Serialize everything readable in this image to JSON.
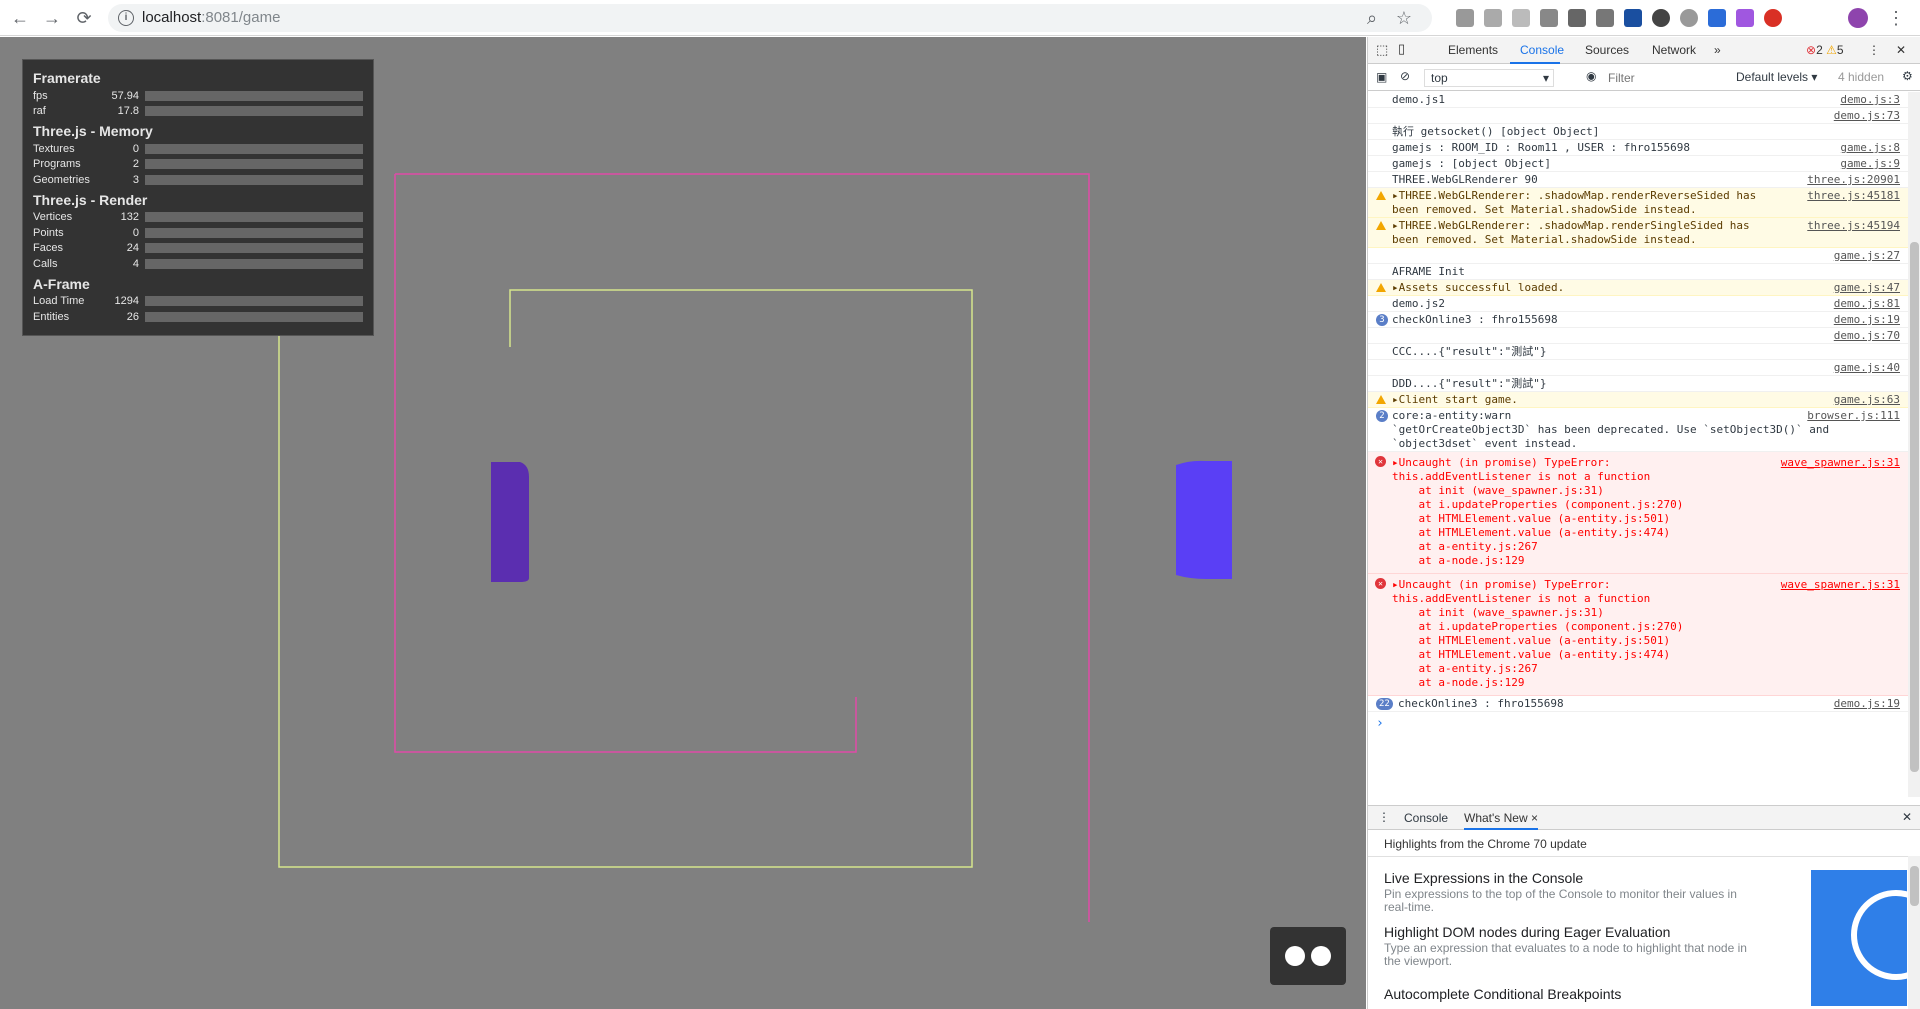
{
  "browser": {
    "url_host": "localhost",
    "url_rest": ":8081/game"
  },
  "stats": {
    "sections": [
      {
        "title": "Framerate",
        "rows": [
          {
            "k": "fps",
            "v": "57.94"
          },
          {
            "k": "raf",
            "v": "17.8"
          }
        ]
      },
      {
        "title": "Three.js - Memory",
        "rows": [
          {
            "k": "Textures",
            "v": "0"
          },
          {
            "k": "Programs",
            "v": "2"
          },
          {
            "k": "Geometries",
            "v": "3"
          }
        ]
      },
      {
        "title": "Three.js - Render",
        "rows": [
          {
            "k": "Vertices",
            "v": "132"
          },
          {
            "k": "Points",
            "v": "0"
          },
          {
            "k": "Faces",
            "v": "24"
          },
          {
            "k": "Calls",
            "v": "4"
          }
        ]
      },
      {
        "title": "A-Frame",
        "rows": [
          {
            "k": "Load Time",
            "v": "1294"
          },
          {
            "k": "Entities",
            "v": "26"
          }
        ]
      }
    ]
  },
  "devtools": {
    "tabs": [
      "Elements",
      "Console",
      "Sources",
      "Network"
    ],
    "active_tab": "Console",
    "more_tabs": "»",
    "error_count": "2",
    "warning_count": "5",
    "context": "top",
    "filter_placeholder": "Filter",
    "levels": "Default levels",
    "hidden": "4 hidden",
    "colors": {
      "accent": "#1a73e8",
      "error": "#ff0000",
      "warn_bg": "#fffbe5",
      "err_bg": "#fff0f0"
    },
    "messages": [
      {
        "type": "log",
        "text": "demo.js1",
        "src": "demo.js:3"
      },
      {
        "type": "log",
        "text": "",
        "src": "demo.js:73"
      },
      {
        "type": "log",
        "text": "執行 getsocket() [object Object]",
        "src": ""
      },
      {
        "type": "log",
        "text": "gamejs : ROOM_ID : Room11 , USER : fhro155698",
        "src": "game.js:8"
      },
      {
        "type": "log",
        "text": "gamejs : [object Object]",
        "src": "game.js:9"
      },
      {
        "type": "log",
        "text": "THREE.WebGLRenderer 90",
        "src": "three.js:20901"
      },
      {
        "type": "warn",
        "text": "▸THREE.WebGLRenderer: .shadowMap.renderReverseSided has\nbeen removed. Set Material.shadowSide instead.",
        "src": "three.js:45181"
      },
      {
        "type": "warn",
        "text": "▸THREE.WebGLRenderer: .shadowMap.renderSingleSided has\nbeen removed. Set Material.shadowSide instead.",
        "src": "three.js:45194"
      },
      {
        "type": "log",
        "text": "",
        "src": "game.js:27"
      },
      {
        "type": "log",
        "text": "AFRAME Init",
        "src": ""
      },
      {
        "type": "warn",
        "text": "▸Assets successful loaded.",
        "src": "game.js:47"
      },
      {
        "type": "log",
        "text": "demo.js2",
        "src": "demo.js:81"
      },
      {
        "type": "count",
        "badge": "3",
        "text": "checkOnline3 : fhro155698",
        "src": "demo.js:19"
      },
      {
        "type": "log",
        "text": "",
        "src": "demo.js:70"
      },
      {
        "type": "log",
        "text": "CCC....{\"result\":\"測試\"}",
        "src": ""
      },
      {
        "type": "log",
        "text": "",
        "src": "game.js:40"
      },
      {
        "type": "log",
        "text": "DDD....{\"result\":\"測試\"}",
        "src": ""
      },
      {
        "type": "warn",
        "text": "▸Client start game.",
        "src": "game.js:63"
      },
      {
        "type": "count",
        "badge": "2",
        "text": "core:a-entity:warn\n`getOrCreateObject3D` has been deprecated. Use `setObject3D()` and\n`object3dset` event instead.",
        "src": "browser.js:111"
      },
      {
        "type": "error",
        "text": "▸Uncaught (in promise) TypeError:\nthis.addEventListener is not a function\n    at init (wave_spawner.js:31)\n    at i.updateProperties (component.js:270)\n    at HTMLElement.value (a-entity.js:501)\n    at HTMLElement.value (a-entity.js:474)\n    at a-entity.js:267\n    at a-node.js:129",
        "src": "wave_spawner.js:31"
      },
      {
        "type": "error",
        "text": "▸Uncaught (in promise) TypeError:\nthis.addEventListener is not a function\n    at init (wave_spawner.js:31)\n    at i.updateProperties (component.js:270)\n    at HTMLElement.value (a-entity.js:501)\n    at HTMLElement.value (a-entity.js:474)\n    at a-entity.js:267\n    at a-node.js:129",
        "src": "wave_spawner.js:31"
      },
      {
        "type": "count",
        "badge": "22",
        "text": "checkOnline3 : fhro155698",
        "src": "demo.js:19"
      }
    ],
    "prompt": "›",
    "drawer": {
      "tabs": [
        "Console",
        "What's New"
      ],
      "active": "What's New",
      "close": "×",
      "highlights": "Highlights from the Chrome 70 update",
      "items": [
        {
          "title": "Live Expressions in the Console",
          "desc": "Pin expressions to the top of the Console to monitor their values in real-time."
        },
        {
          "title": "Highlight DOM nodes during Eager Evaluation",
          "desc": "Type an expression that evaluates to a node to highlight that node in the viewport."
        },
        {
          "title": "Autocomplete Conditional Breakpoints",
          "desc": ""
        }
      ]
    }
  }
}
